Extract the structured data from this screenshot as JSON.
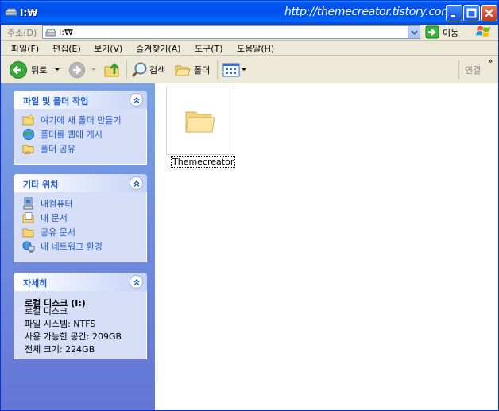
{
  "window": {
    "title": "I:₩",
    "watermark_url": "http://themecreator.tistory.com/"
  },
  "address": {
    "label": "주소(D)",
    "value": "I:₩",
    "go_label": "이동"
  },
  "menu": [
    {
      "label": "파일(F)"
    },
    {
      "label": "편집(E)"
    },
    {
      "label": "보기(V)"
    },
    {
      "label": "즐겨찾기(A)"
    },
    {
      "label": "도구(T)"
    },
    {
      "label": "도움말(H)"
    }
  ],
  "toolbar": {
    "back_label": "뒤로",
    "search_label": "검색",
    "folders_label": "폴더",
    "links_label": "연결",
    "chevron": "»"
  },
  "sidebar": {
    "file_tasks": {
      "title": "파일 및 폴더 작업",
      "items": [
        {
          "label": "여기에 새 폴더 만들기",
          "icon": "new-folder-icon"
        },
        {
          "label": "폴더를 웹에 게시",
          "icon": "publish-web-icon"
        },
        {
          "label": "폴더 공유",
          "icon": "share-folder-icon"
        }
      ]
    },
    "other_places": {
      "title": "기타 위치",
      "items": [
        {
          "label": "내컴퓨터",
          "icon": "my-computer-icon"
        },
        {
          "label": "내 문서",
          "icon": "my-documents-icon"
        },
        {
          "label": "공유 문서",
          "icon": "shared-documents-icon"
        },
        {
          "label": "내 네트워크 환경",
          "icon": "network-icon"
        }
      ]
    },
    "details": {
      "title": "자세히",
      "name": "로컬 디스크 (I:)",
      "type": "로컬 디스크",
      "filesystem": "파일 시스템: NTFS",
      "free": "사용 가능한 공간: 209GB",
      "total": "전체 크기: 224GB"
    }
  },
  "content": {
    "items": [
      {
        "name": "Themecreator",
        "icon": "folder-icon"
      }
    ]
  },
  "colors": {
    "titlebar": "#0053ee",
    "sidebar_top": "#7ba2e7",
    "sidebar_bottom": "#6375d6",
    "task_text": "#215dc6"
  }
}
